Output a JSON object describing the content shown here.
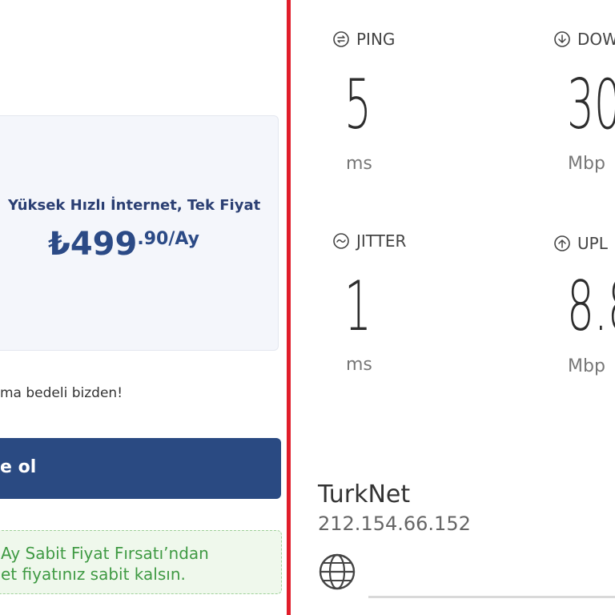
{
  "offer": {
    "tagline": "Yüksek Hızlı İnternet, Tek Fiyat",
    "currency": "₺",
    "price_main": "499",
    "price_suffix": ".90/Ay",
    "note": "ma bedeli bizden!",
    "cta_label": "e ol",
    "promo_line1": "Ay Sabit Fiyat Fırsatı’ndan",
    "promo_line2": "et fiyatınız sabit kalsın."
  },
  "speedtest": {
    "ping": {
      "label": "PING",
      "value": "5",
      "unit": "ms",
      "icon": "ping-icon"
    },
    "download": {
      "label": "DOW",
      "value": "30",
      "unit": "Mbp",
      "icon": "download-icon"
    },
    "jitter": {
      "label": "JITTER",
      "value": "1",
      "unit": "ms",
      "icon": "jitter-icon"
    },
    "upload": {
      "label": "UPL",
      "value": "8.8",
      "unit": "Mbp",
      "icon": "upload-icon"
    },
    "isp_name": "TurkNet",
    "ip_address": "212.154.66.152"
  },
  "colors": {
    "divider": "#e11d2a",
    "cta_background": "#2a4a82",
    "price_text": "#2b4a86",
    "promo_text": "#3f9a43",
    "promo_background": "#eff8ec"
  }
}
